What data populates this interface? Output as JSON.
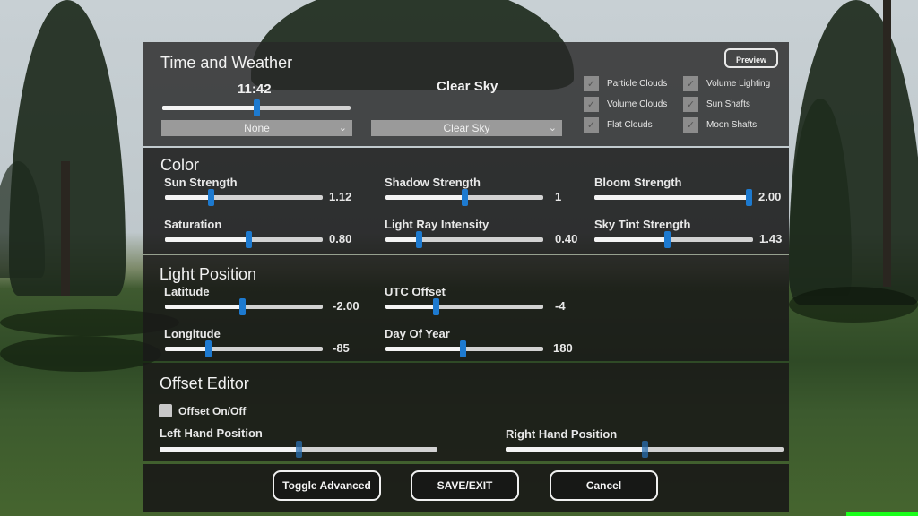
{
  "time_weather": {
    "title": "Time and Weather",
    "time": {
      "label": "11:42",
      "fraction": 0.5
    },
    "time_preset_dropdown": {
      "selected": "None"
    },
    "weather_label": "Clear Sky",
    "weather_dropdown": {
      "selected": "Clear Sky"
    },
    "preview_button": "Preview",
    "checkboxes": [
      {
        "label": "Particle Clouds",
        "checked": true
      },
      {
        "label": "Volume Clouds",
        "checked": true
      },
      {
        "label": "Flat Clouds",
        "checked": true
      },
      {
        "label": "Volume Lighting",
        "checked": true
      },
      {
        "label": "Sun Shafts",
        "checked": true
      },
      {
        "label": "Moon Shafts",
        "checked": true
      }
    ]
  },
  "color": {
    "title": "Color",
    "sliders": [
      {
        "label": "Sun Strength",
        "value": "1.12",
        "fraction": 0.29
      },
      {
        "label": "Shadow Strength",
        "value": "1",
        "fraction": 0.5
      },
      {
        "label": "Bloom Strength",
        "value": "2.00",
        "fraction": 0.98
      },
      {
        "label": "Saturation",
        "value": "0.80",
        "fraction": 0.53
      },
      {
        "label": "Light Ray Intensity",
        "value": "0.40",
        "fraction": 0.21
      },
      {
        "label": "Sky Tint Strength",
        "value": "1.43",
        "fraction": 0.46
      }
    ]
  },
  "light_position": {
    "title": "Light Position",
    "sliders": [
      {
        "label": "Latitude",
        "value": "-2.00",
        "fraction": 0.49
      },
      {
        "label": "UTC Offset",
        "value": "-4",
        "fraction": 0.32
      },
      {
        "label": "Longitude",
        "value": "-85",
        "fraction": 0.27
      },
      {
        "label": "Day Of Year",
        "value": "180",
        "fraction": 0.49
      }
    ]
  },
  "offset_editor": {
    "title": "Offset Editor",
    "toggle": {
      "label": "Offset On/Off",
      "checked": false
    },
    "sliders": [
      {
        "label": "Left Hand Position",
        "fraction": 0.5
      },
      {
        "label": "Right Hand Position",
        "fraction": 0.5
      }
    ]
  },
  "footer": {
    "toggle_advanced": "Toggle Advanced",
    "save_exit": "SAVE/EXIT",
    "cancel": "Cancel"
  },
  "icons": {
    "check": "✓",
    "chevron_down": "⌄"
  },
  "colors": {
    "slider_thumb": "#1d7ad0",
    "panel_bg": "#161616",
    "indicator_green": "#1aff1a"
  }
}
